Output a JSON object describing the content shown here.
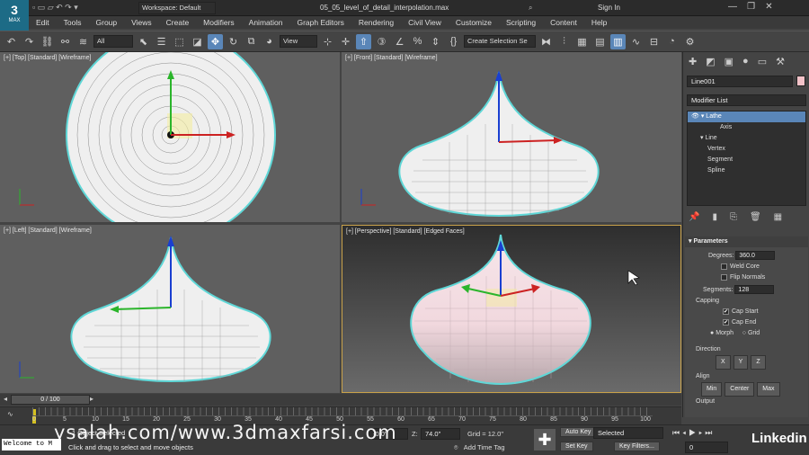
{
  "app": {
    "logo_text": "3",
    "logo_sub": "MAX",
    "workspace": "Workspace: Default",
    "file_title": "05_05_level_of_detail_interpolation.max",
    "sign_in": "Sign In"
  },
  "menu": [
    "Edit",
    "Tools",
    "Group",
    "Views",
    "Create",
    "Modifiers",
    "Animation",
    "Graph Editors",
    "Rendering",
    "Civil View",
    "Customize",
    "Scripting",
    "Content",
    "Help"
  ],
  "toolbar": {
    "filter": "All",
    "ref_coord": "View",
    "selection_set": "Create Selection Se"
  },
  "viewports": {
    "top": "[+] [Top] [Standard] [Wireframe]",
    "front": "[+] [Front] [Standard] [Wireframe]",
    "left": "[+] [Left] [Standard] [Wireframe]",
    "perspective": "[+] [Perspective] [Standard] [Edged Faces]"
  },
  "command_panel": {
    "object_name": "Line001",
    "modifier_list": "Modifier List",
    "stack": [
      "Lathe",
      "Axis",
      "Line",
      "Vertex",
      "Segment",
      "Spline"
    ],
    "rollout_title": "Parameters",
    "degrees_label": "Degrees:",
    "degrees_value": "360.0",
    "weld_core": "Weld Core",
    "flip_normals": "Flip Normals",
    "segments_label": "Segments:",
    "segments_value": "128",
    "capping": "Capping",
    "cap_start": "Cap Start",
    "cap_end": "Cap End",
    "morph": "Morph",
    "grid": "Grid",
    "direction": "Direction",
    "dir_x": "X",
    "dir_y": "Y",
    "dir_z": "Z",
    "align": "Align",
    "align_min": "Min",
    "align_center": "Center",
    "align_max": "Max",
    "output": "Output"
  },
  "timeline": {
    "frame_display": "0 / 100",
    "ticks": [
      "0",
      "5",
      "10",
      "15",
      "20",
      "25",
      "30",
      "35",
      "40",
      "45",
      "50",
      "55",
      "60",
      "65",
      "70",
      "75",
      "80",
      "85",
      "90",
      "95",
      "100"
    ]
  },
  "status": {
    "selection": "1 Object Selected",
    "prompt": "Click and drag to select and move objects",
    "x_value": "-0.0\"",
    "z_label": "Z:",
    "z_value": "74.0\"",
    "grid": "Grid = 12.0\"",
    "add_time_tag": "Add Time Tag",
    "auto_key": "Auto Key",
    "set_key": "Set Key",
    "selected": "Selected",
    "key_filters": "Key Filters...",
    "frame": "0",
    "listener": "Welcome to M"
  },
  "watermark": "ysalah.com/www.3dmaxfarsi.com",
  "brand": "Linkedin"
}
